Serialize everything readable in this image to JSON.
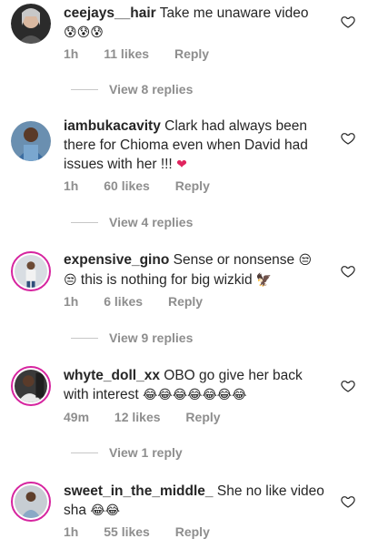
{
  "comments": [
    {
      "username": "ceejays__hair",
      "text": "Take me unaware video",
      "emojis": [
        "😰😰😰"
      ],
      "time": "1h",
      "likes": "11 likes",
      "reply": "Reply",
      "view_replies": "View 8 replies"
    },
    {
      "username": "iambukacavity",
      "text": "Clark had always been there for Chioma even when David had issues with her !!!",
      "emojis": [
        "❤"
      ],
      "time": "1h",
      "likes": "60 likes",
      "reply": "Reply",
      "view_replies": "View 4 replies"
    },
    {
      "username": "expensive_gino",
      "text_a": "Sense or nonsense",
      "emoji_a": "😒",
      "emoji_b": "😒",
      "text_b": "this is nothing for big wizkid",
      "emoji_c": "🦅",
      "time": "1h",
      "likes": "6 likes",
      "reply": "Reply",
      "view_replies": "View 9 replies"
    },
    {
      "username": "whyte_doll_xx",
      "text": "OBO go give her  back with interest",
      "emojis": [
        "😂😂😂😂😂😂😂"
      ],
      "time": "49m",
      "likes": "12 likes",
      "reply": "Reply",
      "view_replies": "View 1 reply"
    },
    {
      "username": "sweet_in_the_middle_",
      "text": "She no like video sha",
      "emojis": [
        "😂😂"
      ],
      "time": "1h",
      "likes": "55 likes",
      "reply": "Reply"
    }
  ],
  "icons": {
    "like": "heart-outline-icon"
  },
  "colors": {
    "text": "#262626",
    "muted": "#8e8e8e",
    "story_ring": "#d6249f"
  }
}
